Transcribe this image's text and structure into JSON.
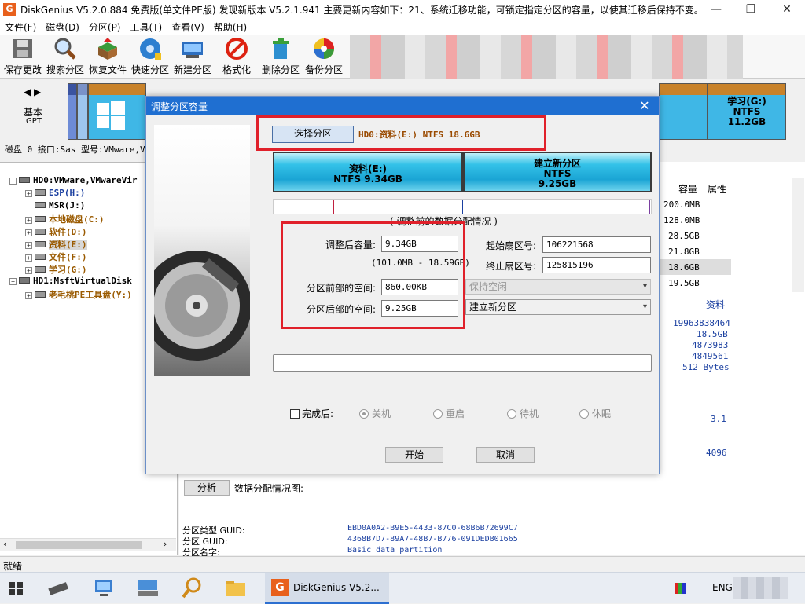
{
  "window": {
    "title": "DiskGenius V5.2.0.884 免费版(单文件PE版)   发现新版本 V5.2.1.941 主要更新内容如下：21、系统迁移功能，可锁定指定分区的容量，以使其迁移后保持不变。",
    "minimize": "—",
    "maximize": "❐",
    "close": "✕"
  },
  "menu": [
    "文件(F)",
    "磁盘(D)",
    "分区(P)",
    "工具(T)",
    "查看(V)",
    "帮助(H)"
  ],
  "toolbar": [
    {
      "label": "保存更改",
      "icon": "save-disk-icon"
    },
    {
      "label": "搜索分区",
      "icon": "magnifier-icon"
    },
    {
      "label": "恢复文件",
      "icon": "recover-box-icon"
    },
    {
      "label": "快速分区",
      "icon": "quick-partition-icon"
    },
    {
      "label": "新建分区",
      "icon": "new-partition-icon"
    },
    {
      "label": "格式化",
      "icon": "format-icon"
    },
    {
      "label": "删除分区",
      "icon": "trash-icon"
    },
    {
      "label": "备份分区",
      "icon": "backup-icon"
    }
  ],
  "diskmap": {
    "basic": "基本",
    "gpt": "GPT",
    "last_partition": {
      "name": "学习(G:)",
      "fs": "NTFS",
      "size": "11.2GB"
    }
  },
  "disk_info_line": "磁盘 0 接口:Sas  型号:VMware,V",
  "tree": {
    "disk0": "HD0:VMware,VMwareVir",
    "partitions": [
      {
        "label": "ESP(H:)",
        "color": "#1a3fa0"
      },
      {
        "label": "MSR(J:)",
        "color": "#000000"
      },
      {
        "label": "本地磁盘(C:)",
        "color": "#9a5a00"
      },
      {
        "label": "软件(D:)",
        "color": "#9a5a00"
      },
      {
        "label": "资料(E:)",
        "color": "#9a5a00"
      },
      {
        "label": "文件(F:)",
        "color": "#9a5a00"
      },
      {
        "label": "学习(G:)",
        "color": "#9a5a00"
      }
    ],
    "disk1": "HD1:MsftVirtualDisk",
    "disk1_partition": "老毛桃PE工具盘(Y:)"
  },
  "right_table": {
    "col_capacity": "容量",
    "col_attr": "属性",
    "sizes": [
      "200.0MB",
      "128.0MB",
      "28.5GB",
      "21.8GB",
      "18.6GB",
      "19.5GB"
    ]
  },
  "right_details": {
    "name": "资料",
    "v1": "19963838464",
    "v2": "18.5GB",
    "v3": "4873983",
    "v4": "4849561",
    "v5": "512 Bytes",
    "v6": "3.1",
    "v7": "4096"
  },
  "bottom_panel": {
    "analyze_button": "分析",
    "chart_label": "数据分配情况图:",
    "type_guid_key": "分区类型 GUID:",
    "type_guid_val": "EBD0A0A2-B9E5-4433-87C0-68B6B72699C7",
    "guid_key": "分区 GUID:",
    "guid_val": "4368B7D7-89A7-48B7-B776-091DEDB01665",
    "name_key": "分区名字:",
    "name_val": "Basic data partition"
  },
  "status": "就绪",
  "taskbar": {
    "active_app": "DiskGenius V5.2...",
    "lang": "ENG"
  },
  "dialog": {
    "title": "调整分区容量",
    "close": "✕",
    "select_button": "选择分区",
    "selected_partition": "HD0:资料(E:) NTFS 18.6GB",
    "part_left": {
      "name": "资料(E:)",
      "line2": "NTFS 9.34GB"
    },
    "part_right": {
      "name": "建立新分区",
      "line2": "NTFS",
      "line3": "9.25GB"
    },
    "caption": "( 调整前的数据分配情况 )",
    "resize_label": "调整后容量:",
    "resize_value": "9.34GB",
    "range": "(101.0MB - 18.59GB)",
    "before_label": "分区前部的空间:",
    "before_value": "860.00KB",
    "after_label": "分区后部的空间:",
    "after_value": "9.25GB",
    "start_sector_label": "起始扇区号:",
    "start_sector_value": "106221568",
    "end_sector_label": "终止扇区号:",
    "end_sector_value": "125815196",
    "before_action": "保持空闲",
    "after_action": "建立新分区",
    "finish_label": "完成后:",
    "radio_shutdown": "关机",
    "radio_restart": "重启",
    "radio_standby": "待机",
    "radio_sleep": "休眠",
    "start_button": "开始",
    "cancel_button": "取消",
    "highlight_color": "#e0202a"
  }
}
